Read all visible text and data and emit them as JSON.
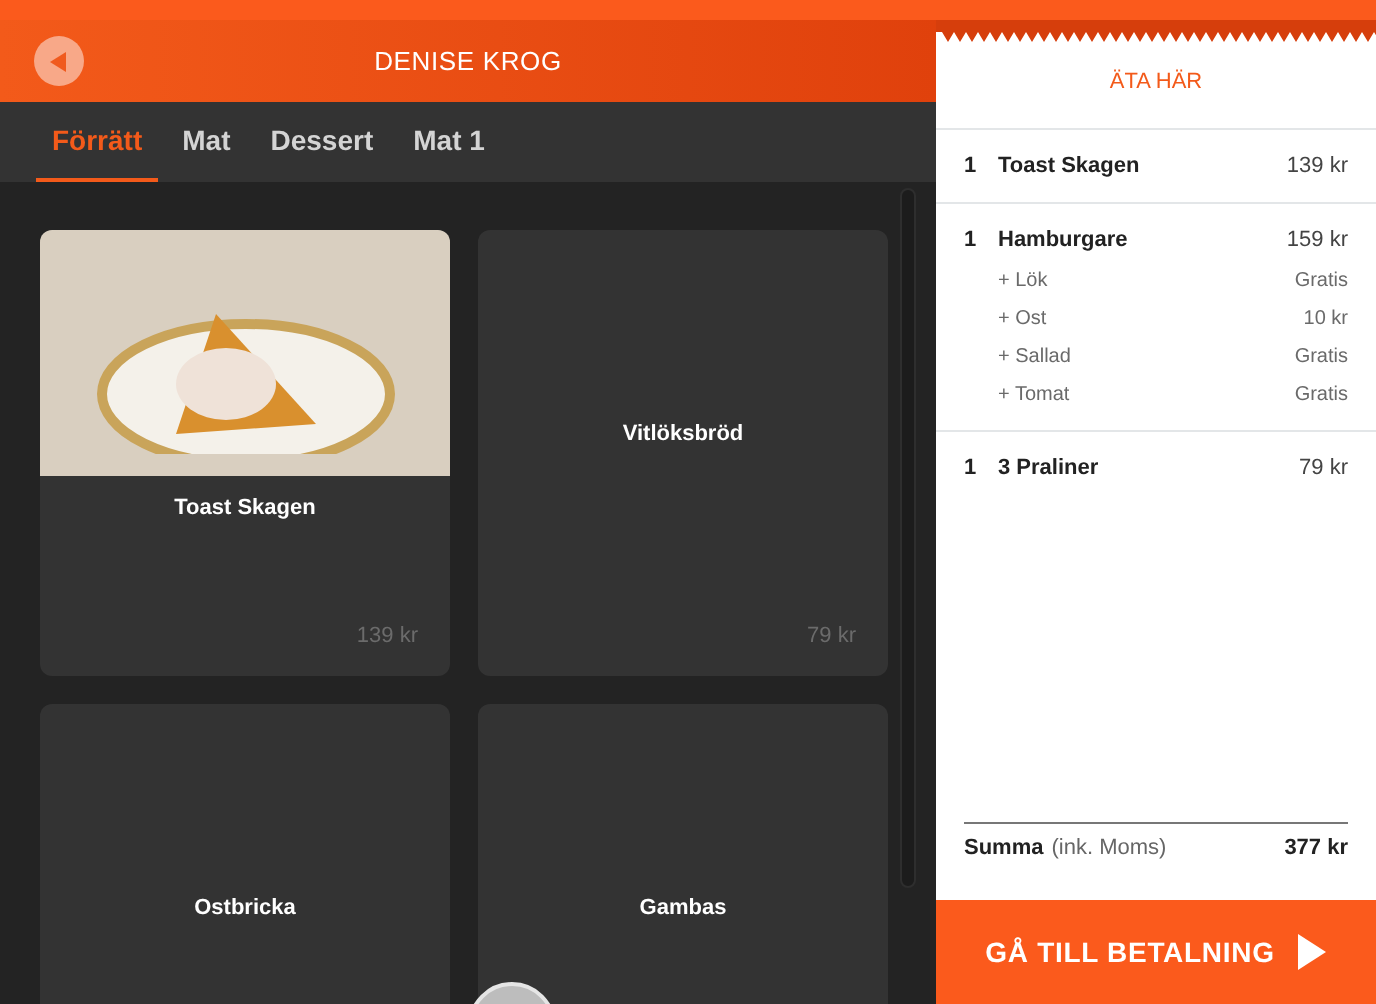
{
  "header": {
    "title": "DENISE KROG"
  },
  "tabs": [
    {
      "label": "Förrätt",
      "selected": true
    },
    {
      "label": "Mat",
      "selected": false
    },
    {
      "label": "Dessert",
      "selected": false
    },
    {
      "label": "Mat 1",
      "selected": false
    }
  ],
  "products": [
    {
      "kind": "photo",
      "name": "Toast Skagen",
      "price": "139 kr"
    },
    {
      "kind": "plain",
      "name": "Vitlöksbröd",
      "price": "79 kr"
    },
    {
      "kind": "plain",
      "name": "Ostbricka"
    },
    {
      "kind": "plain",
      "name": "Gambas"
    }
  ],
  "order": {
    "title": "ÄTA HÄR",
    "items": [
      {
        "qty": "1",
        "name": "Toast Skagen",
        "price": "139 kr"
      },
      {
        "qty": "1",
        "name": "Hamburgare",
        "price": "159 kr",
        "addons": [
          {
            "name": "+ Lök",
            "price": "Gratis"
          },
          {
            "name": "+ Ost",
            "price": "10 kr"
          },
          {
            "name": "+ Sallad",
            "price": "Gratis"
          },
          {
            "name": "+ Tomat",
            "price": "Gratis"
          }
        ]
      },
      {
        "qty": "1",
        "name": "3 Praliner",
        "price": "79 kr"
      }
    ],
    "total_label": "Summa",
    "total_note": "(ink. Moms)",
    "total": "377 kr",
    "checkout": "GÅ TILL BETALNING"
  }
}
